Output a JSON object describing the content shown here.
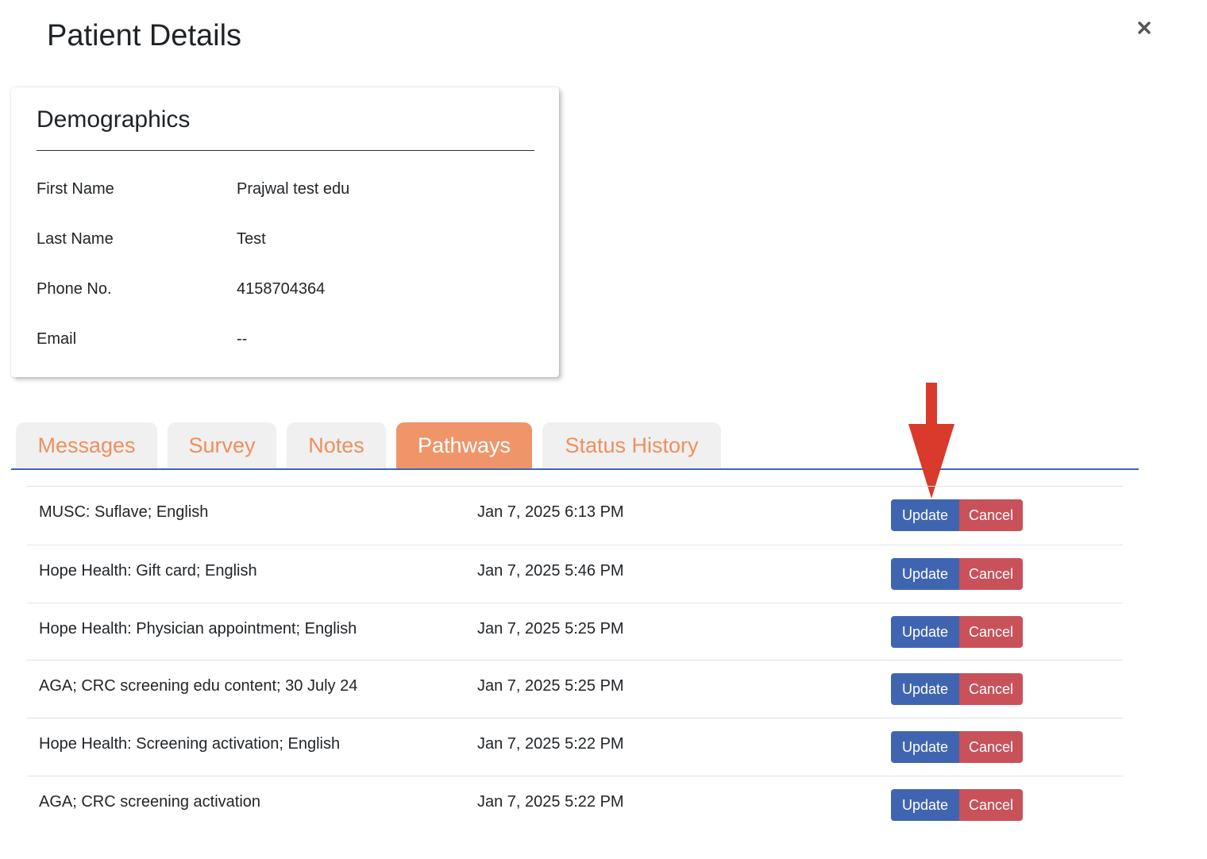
{
  "header": {
    "title": "Patient Details",
    "close_icon": "close-icon"
  },
  "demographics": {
    "title": "Demographics",
    "fields": [
      {
        "label": "First Name",
        "value": "Prajwal test edu"
      },
      {
        "label": "Last Name",
        "value": "Test"
      },
      {
        "label": "Phone No.",
        "value": "4158704364"
      },
      {
        "label": "Email",
        "value": "--"
      }
    ]
  },
  "tabs": [
    {
      "label": "Messages",
      "active": false
    },
    {
      "label": "Survey",
      "active": false
    },
    {
      "label": "Notes",
      "active": false
    },
    {
      "label": "Pathways",
      "active": true
    },
    {
      "label": "Status History",
      "active": false
    }
  ],
  "pathways": [
    {
      "name": "MUSC: Suflave; English",
      "date": "Jan 7, 2025 6:13 PM"
    },
    {
      "name": "Hope Health: Gift card; English",
      "date": "Jan 7, 2025 5:46 PM"
    },
    {
      "name": "Hope Health: Physician appointment; English",
      "date": "Jan 7, 2025 5:25 PM"
    },
    {
      "name": "AGA; CRC screening edu content; 30 July 24",
      "date": "Jan 7, 2025 5:25 PM"
    },
    {
      "name": "Hope Health: Screening activation; English",
      "date": "Jan 7, 2025 5:22 PM"
    },
    {
      "name": "AGA; CRC screening activation",
      "date": "Jan 7, 2025 5:22 PM"
    }
  ],
  "actions": {
    "update_label": "Update",
    "cancel_label": "Cancel"
  },
  "colors": {
    "tab_accent": "#f0956a",
    "tab_text": "#ef8f60",
    "update_button": "#4065b0",
    "cancel_button": "#c9515a",
    "arrow": "#d93a2b"
  }
}
